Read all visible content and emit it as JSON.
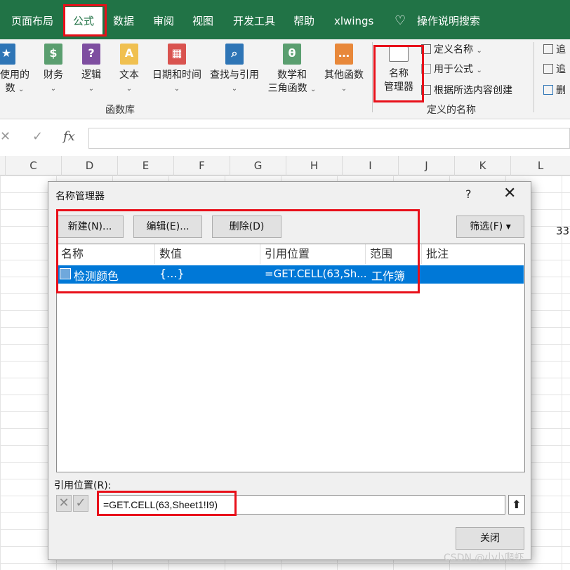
{
  "ribbon_tabs": [
    "页面布局",
    "公式",
    "数据",
    "审阅",
    "视图",
    "开发工具",
    "帮助",
    "xlwings",
    "操作说明搜索"
  ],
  "ribbon": {
    "function_library": [
      {
        "label_line1": "使用的",
        "label_line2": "数",
        "icon": "star-icon",
        "color": "#2e75b6",
        "glyph": "★"
      },
      {
        "label_line1": "财务",
        "label_line2": "",
        "icon": "finance-icon",
        "color": "#5a9e6f",
        "glyph": "$"
      },
      {
        "label_line1": "逻辑",
        "label_line2": "",
        "icon": "logic-icon",
        "color": "#7e4ea0",
        "glyph": "?"
      },
      {
        "label_line1": "文本",
        "label_line2": "",
        "icon": "text-icon",
        "color": "#f0c050",
        "glyph": "A"
      },
      {
        "label_line1": "日期和时间",
        "label_line2": "",
        "icon": "calendar-icon",
        "color": "#d9534f",
        "glyph": "▦"
      },
      {
        "label_line1": "查找与引用",
        "label_line2": "",
        "icon": "lookup-icon",
        "color": "#2e75b6",
        "glyph": "⌕"
      },
      {
        "label_line1": "数学和",
        "label_line2": "三角函数",
        "icon": "math-icon",
        "color": "#5a9e6f",
        "glyph": "θ"
      },
      {
        "label_line1": "其他函数",
        "label_line2": "",
        "icon": "more-functions-icon",
        "color": "#e8883a",
        "glyph": "…"
      }
    ],
    "function_library_label": "函数库",
    "name_manager_line1": "名称",
    "name_manager_line2": "管理器",
    "define_name": "定义名称",
    "use_in_formula": "用于公式",
    "create_from_selection": "根据所选内容创建",
    "defined_names_label": "定义的名称",
    "audit_1": "追",
    "audit_2": "追",
    "audit_3": "删"
  },
  "formula_bar": {
    "cancel": "✕",
    "enter": "✓",
    "fx": "fx",
    "value": ""
  },
  "columns": [
    "C",
    "D",
    "E",
    "F",
    "G",
    "H",
    "I",
    "J",
    "K",
    "L"
  ],
  "cell_value": "33",
  "dialog": {
    "title": "名称管理器",
    "help": "?",
    "close": "✕",
    "new_button": "新建(N)...",
    "edit_button": "编辑(E)...",
    "delete_button": "删除(D)",
    "filter_button": "筛选(F) ▾",
    "headers": [
      "名称",
      "数值",
      "引用位置",
      "范围",
      "批注"
    ],
    "rows": [
      {
        "name": "检测颜色",
        "value": "{...}",
        "refers_to": "=GET.CELL(63,Sh...",
        "scope": "工作簿",
        "comment": ""
      }
    ],
    "refers_to_label": "引用位置(R):",
    "refers_to_value": "=GET.CELL(63,Sheet1!I9)",
    "close_button": "关闭"
  },
  "watermark": "CSDN @小小爬虾",
  "colors": {
    "excel_green": "#217346",
    "selection_blue": "#0078d7",
    "highlight_red": "#e8101a"
  }
}
